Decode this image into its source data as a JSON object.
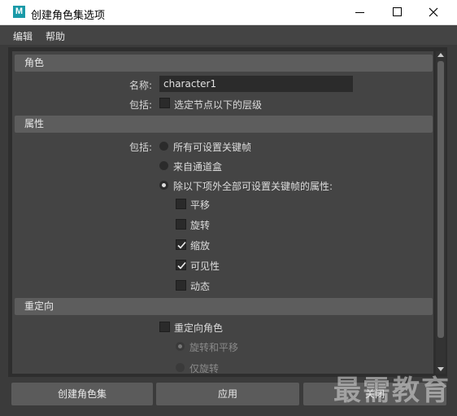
{
  "window": {
    "title": "创建角色集选项",
    "app_icon_letter": "M"
  },
  "menu": {
    "items": [
      "编辑",
      "帮助"
    ]
  },
  "sections": {
    "character": {
      "header": "角色",
      "name_label": "名称:",
      "name_value": "character1",
      "include_label": "包括:",
      "include_checkbox_label": "选定节点以下的层级",
      "include_checked": false
    },
    "attributes": {
      "header": "属性",
      "include_label": "包括:",
      "radios": [
        {
          "label": "所有可设置关键帧",
          "selected": false
        },
        {
          "label": "来自通道盒",
          "selected": false
        },
        {
          "label": "除以下项外全部可设置关键帧的属性:",
          "selected": true
        }
      ],
      "checkboxes": [
        {
          "label": "平移",
          "checked": false
        },
        {
          "label": "旋转",
          "checked": false
        },
        {
          "label": "缩放",
          "checked": true
        },
        {
          "label": "可见性",
          "checked": true
        },
        {
          "label": "动态",
          "checked": false
        }
      ]
    },
    "retarget": {
      "header": "重定向",
      "checkbox_label": "重定向角色",
      "checked": false,
      "radios": [
        {
          "label": "旋转和平移",
          "selected": true
        },
        {
          "label": "仅旋转",
          "selected": false
        }
      ]
    }
  },
  "buttons": {
    "create": "创建角色集",
    "apply": "应用",
    "close": "关闭"
  },
  "watermark": "最需教育"
}
